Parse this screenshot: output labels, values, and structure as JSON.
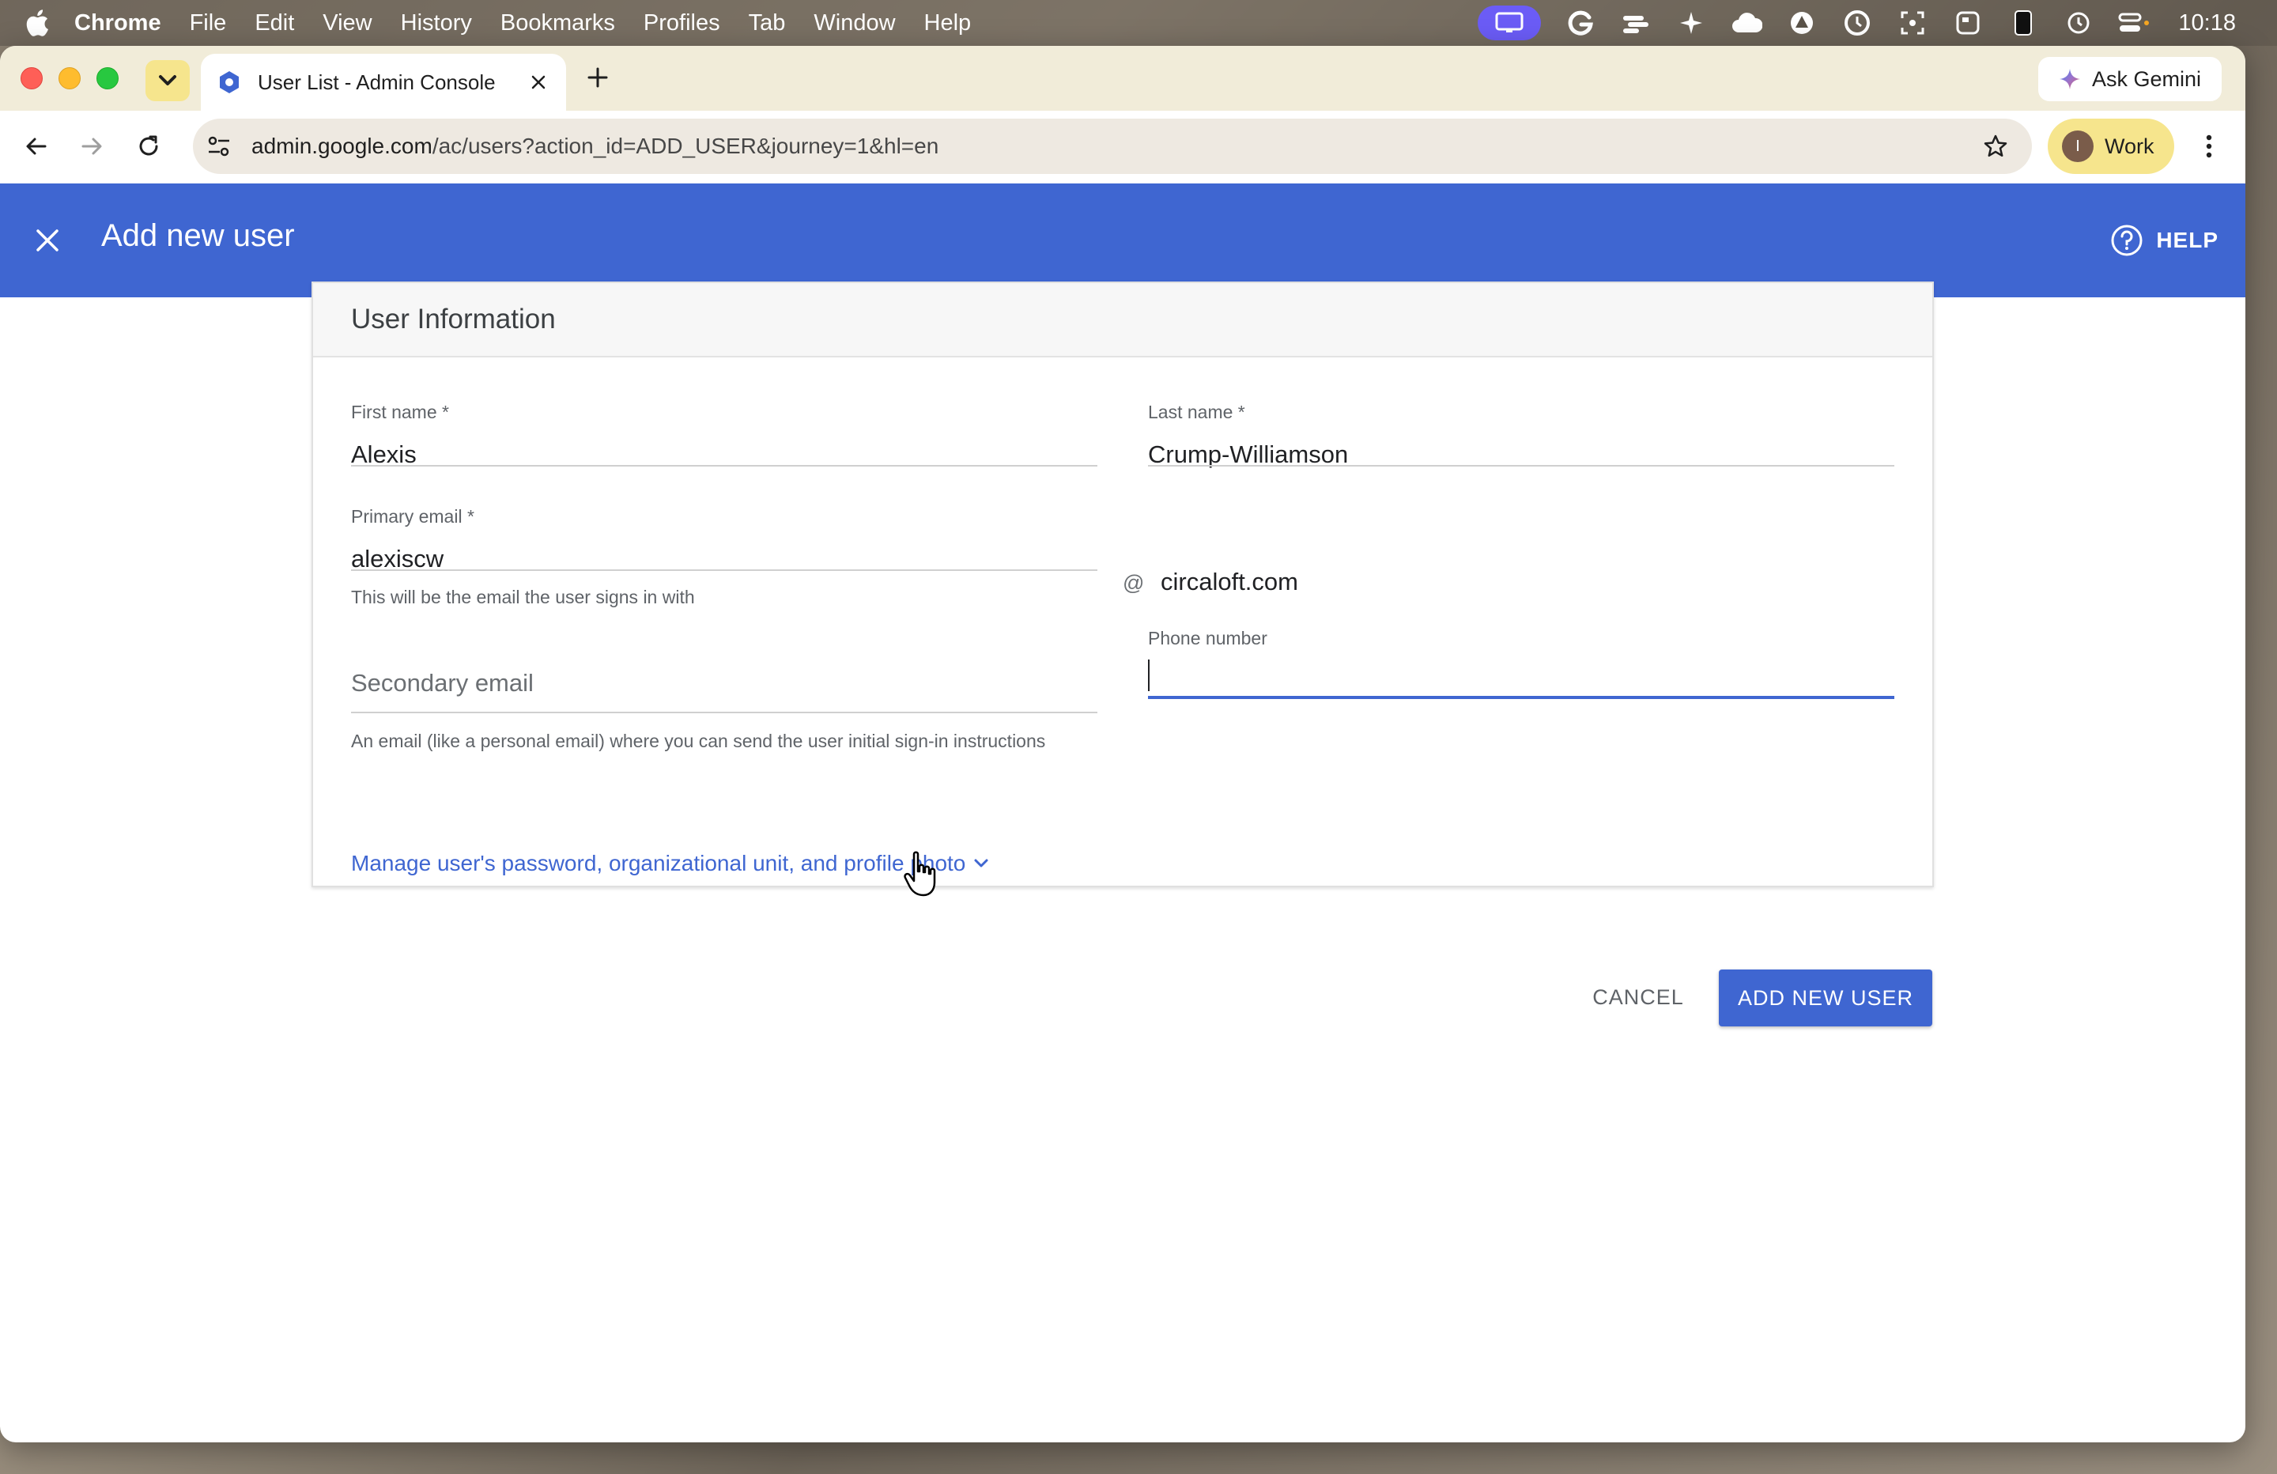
{
  "menubar": {
    "app": "Chrome",
    "items": [
      "File",
      "Edit",
      "View",
      "History",
      "Bookmarks",
      "Profiles",
      "Tab",
      "Window",
      "Help"
    ],
    "clock": "10:18"
  },
  "browser": {
    "tab_title": "User List - Admin Console",
    "url_host": "admin.google.com",
    "url_path": "/ac/users?action_id=ADD_USER&journey=1&hl=en",
    "gemini_label": "Ask Gemini",
    "profile_label": "Work",
    "profile_initial": "I"
  },
  "header": {
    "title": "Add new user",
    "help_label": "HELP"
  },
  "card": {
    "title": "User Information",
    "first_name": {
      "label": "First name *",
      "value": "Alexis"
    },
    "last_name": {
      "label": "Last name *",
      "value": "Crump-Williamson"
    },
    "primary_email": {
      "label": "Primary email *",
      "value": "alexiscw",
      "at": "@",
      "domain": "circaloft.com",
      "helper": "This will be the email the user signs in with"
    },
    "secondary_email": {
      "placeholder": "Secondary email",
      "helper": "An email (like a personal email) where you can send the user initial sign-in instructions"
    },
    "phone": {
      "label": "Phone number",
      "value": ""
    },
    "manage_link": "Manage user's password, organizational unit, and profile photo"
  },
  "actions": {
    "cancel": "CANCEL",
    "add": "ADD NEW USER"
  },
  "colors": {
    "brand_blue": "#3f66d1",
    "tab_strip": "#f1ecd9",
    "profile_yellow": "#f6e58d"
  }
}
